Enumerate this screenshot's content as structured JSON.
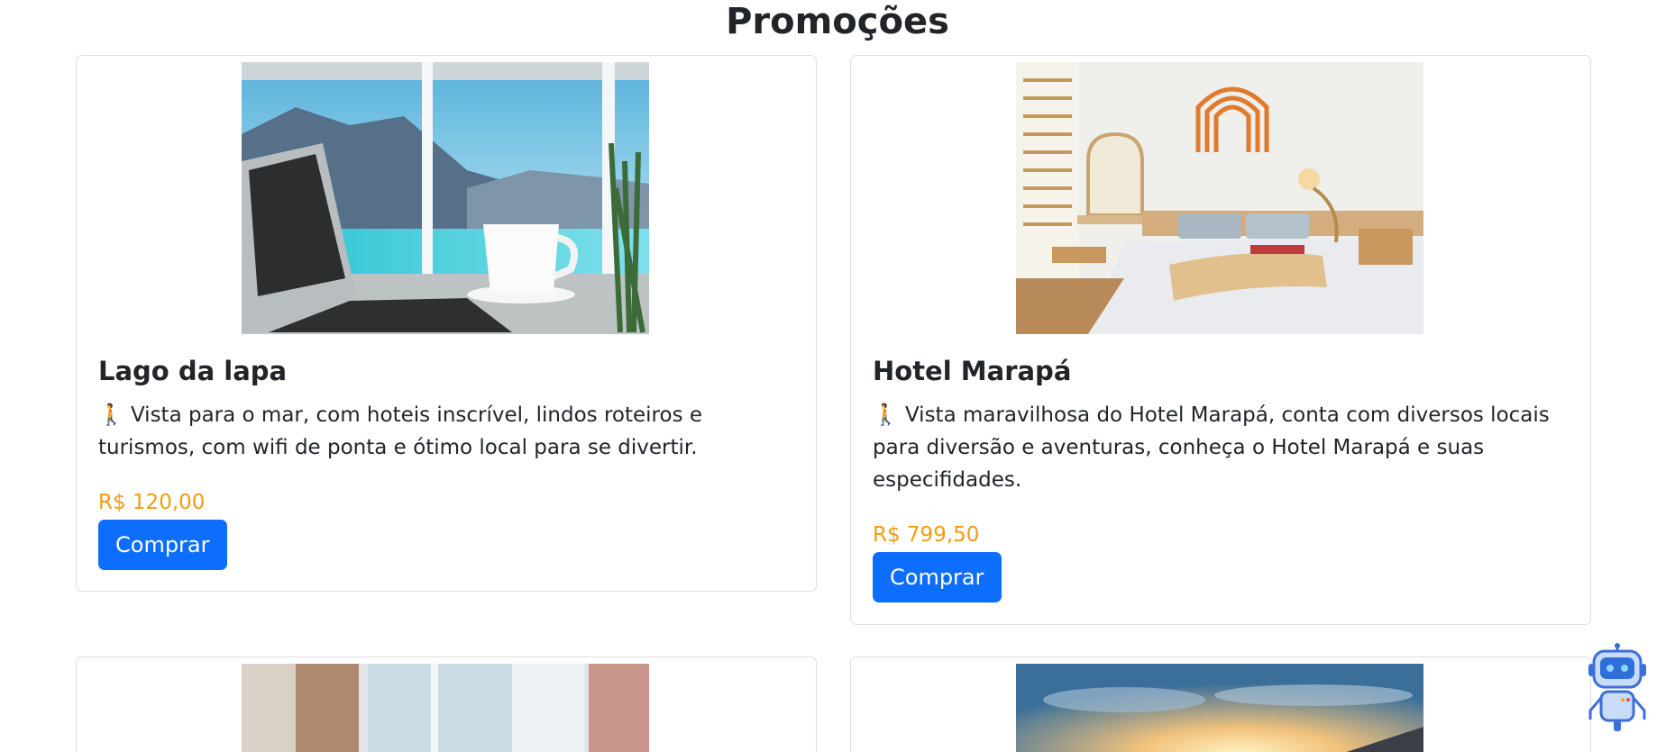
{
  "page": {
    "title": "Promoções"
  },
  "cards": [
    {
      "title": "Lago da lapa",
      "description": "Vista para o mar, com hoteis inscrível, lindos roteiros e turismos, com wifi de ponta e ótimo local para se divertir.",
      "price": "R$ 120,00",
      "button_label": "Comprar",
      "image": "laptop-coffee-lake-view"
    },
    {
      "title": "Hotel Marapá",
      "description": "Vista maravilhosa do Hotel Marapá, conta com diversos locais para diversão e aventuras, conheça o Hotel Marapá e suas especifidades.",
      "price": "R$ 799,50",
      "button_label": "Comprar",
      "image": "hotel-bedroom"
    },
    {
      "image": "room-window-curtains"
    },
    {
      "image": "sunset-sky"
    }
  ],
  "icons": {
    "description_prefix": "walking-person-icon",
    "chatbot": "robot-assistant-icon"
  },
  "colors": {
    "price": "#f39c12",
    "button": "#0d6efd",
    "text": "#212529"
  }
}
